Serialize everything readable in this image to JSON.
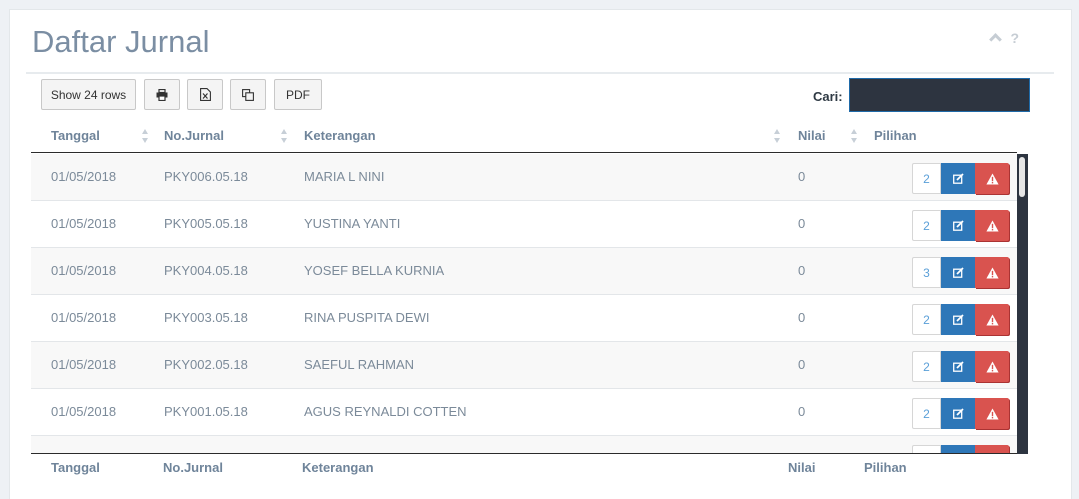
{
  "page": {
    "title": "Daftar Jurnal",
    "help_glyph": "?"
  },
  "toolbar": {
    "show_rows_label": "Show 24 rows",
    "pdf_label": "PDF"
  },
  "search": {
    "label": "Cari:",
    "value": ""
  },
  "columns": {
    "tanggal": "Tanggal",
    "no_jurnal": "No.Jurnal",
    "keterangan": "Keterangan",
    "nilai": "Nilai",
    "pilihan": "Pilihan"
  },
  "rows": [
    {
      "tanggal": "01/05/2018",
      "no_jurnal": "PKY006.05.18",
      "keterangan": "MARIA L NINI",
      "nilai": "0",
      "count": "2"
    },
    {
      "tanggal": "01/05/2018",
      "no_jurnal": "PKY005.05.18",
      "keterangan": "YUSTINA YANTI",
      "nilai": "0",
      "count": "2"
    },
    {
      "tanggal": "01/05/2018",
      "no_jurnal": "PKY004.05.18",
      "keterangan": "YOSEF BELLA KURNIA",
      "nilai": "0",
      "count": "3"
    },
    {
      "tanggal": "01/05/2018",
      "no_jurnal": "PKY003.05.18",
      "keterangan": "RINA PUSPITA DEWI",
      "nilai": "0",
      "count": "2"
    },
    {
      "tanggal": "01/05/2018",
      "no_jurnal": "PKY002.05.18",
      "keterangan": "SAEFUL RAHMAN",
      "nilai": "0",
      "count": "2"
    },
    {
      "tanggal": "01/05/2018",
      "no_jurnal": "PKY001.05.18",
      "keterangan": "AGUS REYNALDI COTTEN",
      "nilai": "0",
      "count": "2"
    },
    {
      "tanggal": "",
      "no_jurnal": "",
      "keterangan": "",
      "nilai": "",
      "count": ""
    }
  ],
  "icons": {
    "print": "print-icon",
    "excel": "excel-icon",
    "copy": "copy-icon",
    "edit": "edit-icon",
    "delete": "warning-icon",
    "collapse": "chevron-up-icon"
  },
  "colors": {
    "primary": "#2e77b8",
    "danger": "#d9534f",
    "header_text": "#6f849a",
    "search_bg": "#2d3440"
  }
}
